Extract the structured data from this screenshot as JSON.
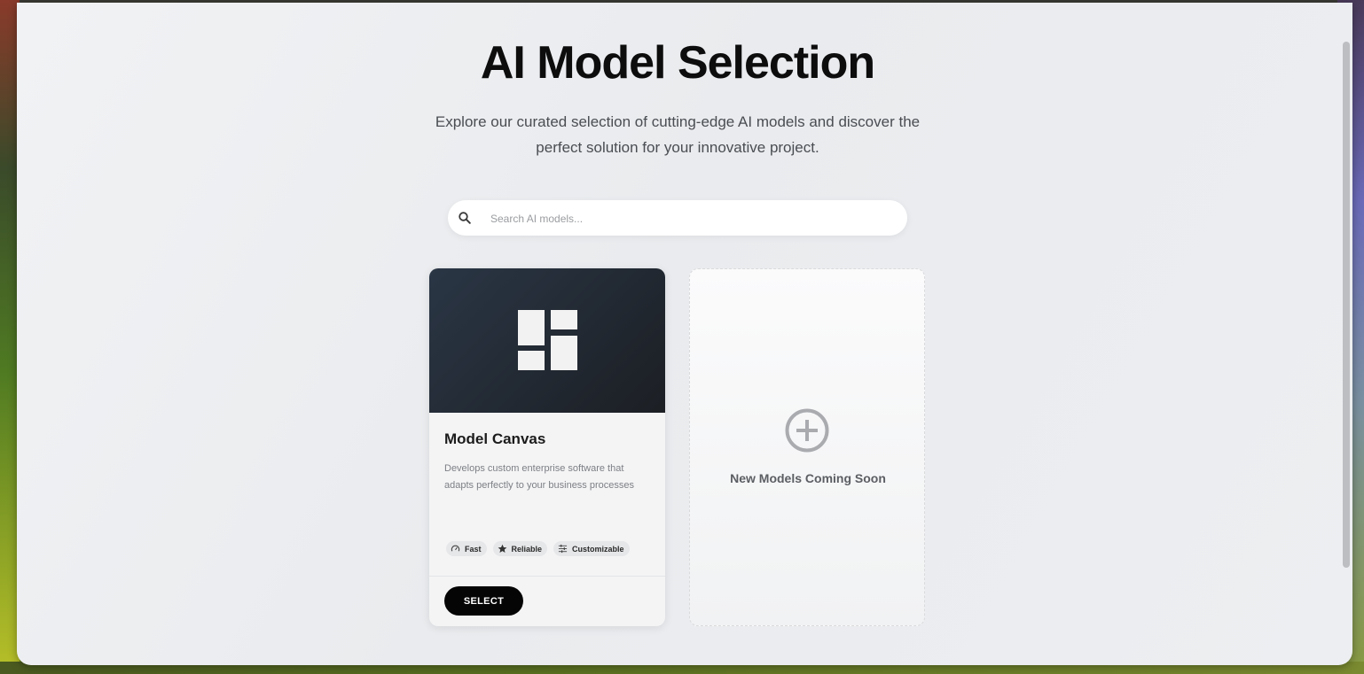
{
  "page": {
    "title": "AI Model Selection",
    "subtitle": "Explore our curated selection of cutting-edge AI models and discover the perfect solution for your innovative project."
  },
  "search": {
    "placeholder": "Search AI models...",
    "icon": "search-icon"
  },
  "models": [
    {
      "name": "Model Canvas",
      "icon": "layout-grid-icon",
      "description": "Develops custom enterprise software that adapts perfectly to your business processes",
      "tags": [
        {
          "label": "Fast",
          "icon": "speedometer-icon"
        },
        {
          "label": "Reliable",
          "icon": "star-icon"
        },
        {
          "label": "Customizable",
          "icon": "sliders-icon"
        }
      ],
      "action_label": "SELECT"
    }
  ],
  "placeholder_card": {
    "label": "New Models Coming Soon",
    "icon": "plus-circle-icon"
  },
  "colors": {
    "banner": "#1e232a",
    "button": "#050505",
    "background": "#eceef1"
  }
}
